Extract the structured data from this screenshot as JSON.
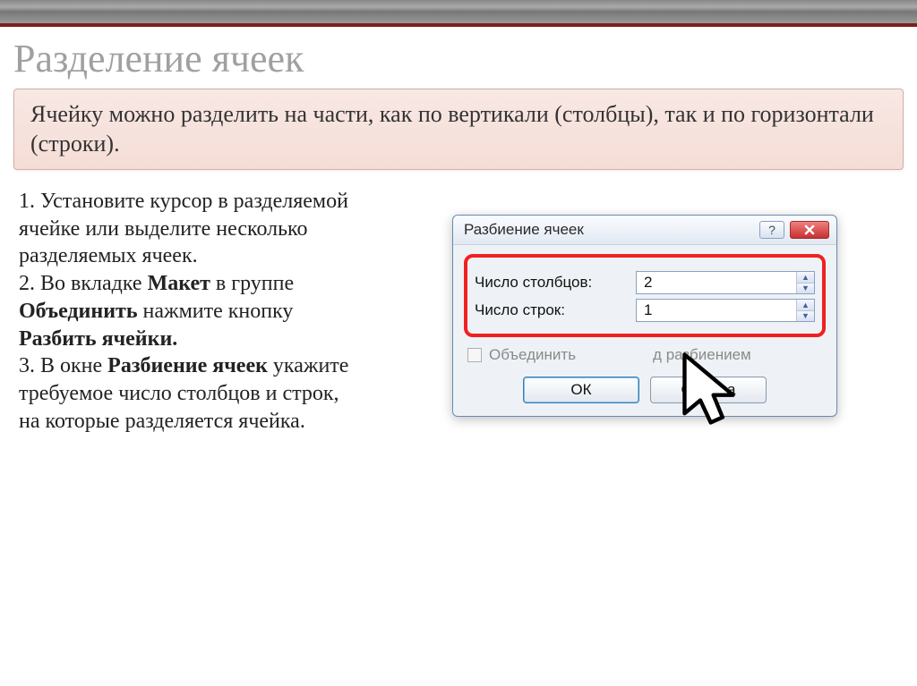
{
  "title": "Разделение ячеек",
  "callout": "Ячейку можно разделить на части, как по вертикали (столбцы), так и по горизонтали (строки).",
  "instructions": {
    "step1_a": "1. Установите курсор в разделяемой ячейке или выделите несколько разделяемых ячеек.",
    "step2_a": "2. Во вкладке ",
    "step2_b": "Макет",
    "step2_c": " в группе ",
    "step2_d": "Объединить",
    "step2_e": " нажмите кнопку ",
    "step2_f": "Разбить ячейки.",
    "step3_a": "3. В окне ",
    "step3_b": "Разбиение ячеек",
    "step3_c": "  укажите требуемое число столбцов и строк, на которые разделяется ячейка."
  },
  "dialog": {
    "title": "Разбиение ячеек",
    "help_glyph": "?",
    "col_label": "Число столбцов:",
    "col_value": "2",
    "row_label": "Число строк:",
    "row_value": "1",
    "checkbox_label_before": "Объединить",
    "checkbox_label_after": "д разбиением",
    "ok": "ОК",
    "cancel": "Отмена"
  }
}
